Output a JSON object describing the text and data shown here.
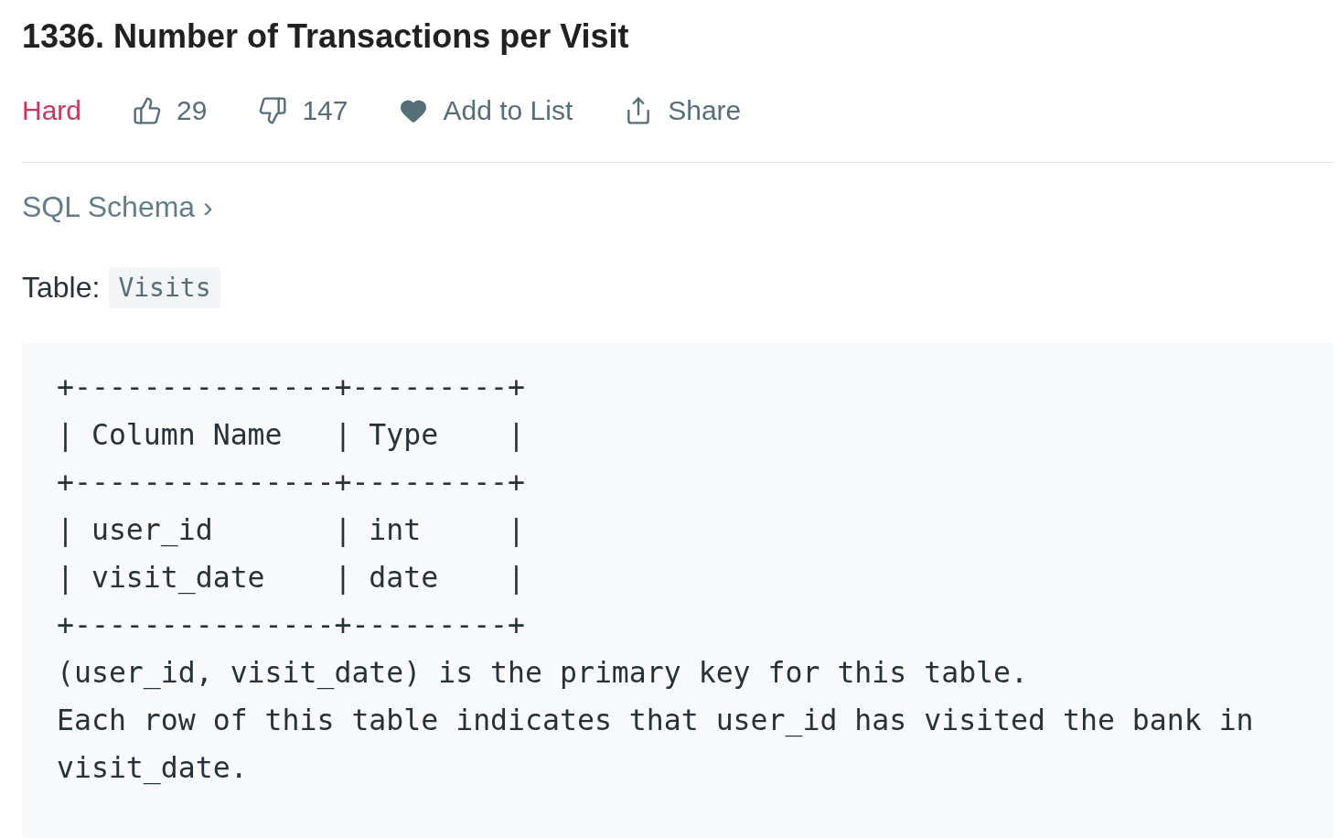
{
  "title": "1336. Number of Transactions per Visit",
  "meta": {
    "difficulty": "Hard",
    "likes": "29",
    "dislikes": "147",
    "add_to_list": "Add to List",
    "share": "Share"
  },
  "schema_link": "SQL Schema ›",
  "table_label": "Table:",
  "table_name": "Visits",
  "code_lines": [
    "+---------------+---------+",
    "| Column Name   | Type    |",
    "+---------------+---------+",
    "| user_id       | int     |",
    "| visit_date    | date    |",
    "+---------------+---------+",
    "(user_id, visit_date) is the primary key for this table.",
    "Each row of this table indicates that user_id has visited the bank in",
    "visit_date."
  ]
}
